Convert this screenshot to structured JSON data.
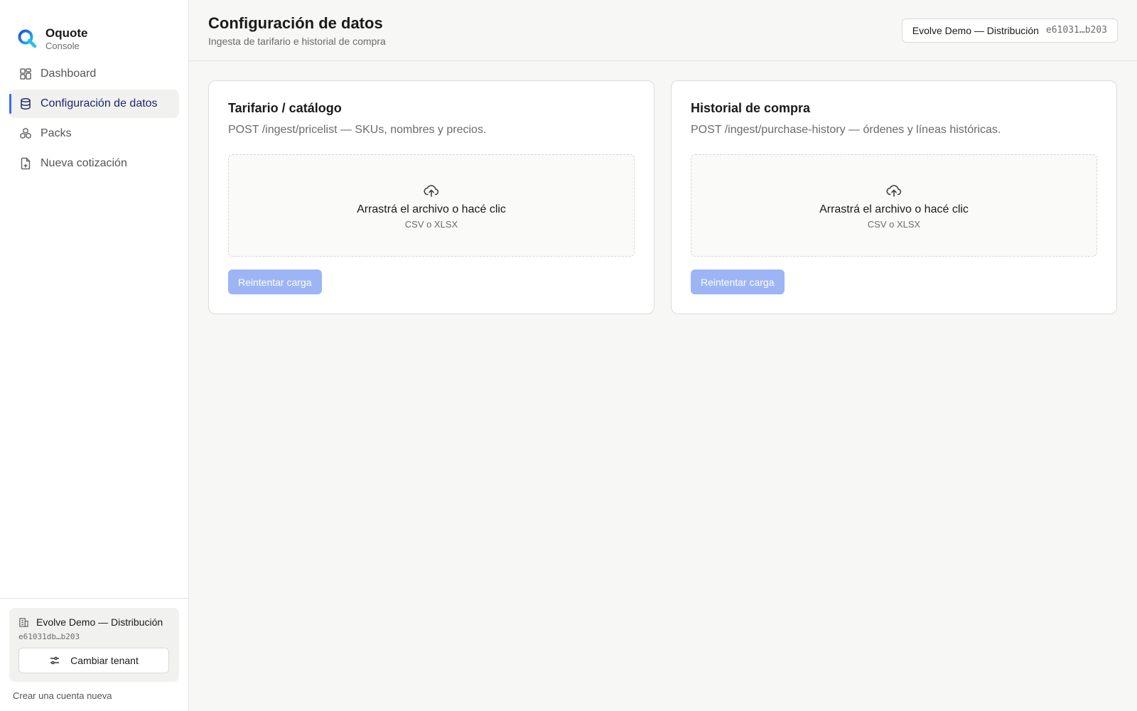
{
  "brand": {
    "name": "Oquote",
    "subtitle": "Console",
    "accent": "#2f6df6"
  },
  "sidebar": {
    "items": [
      {
        "label": "Dashboard",
        "icon": "dashboard-icon",
        "active": false
      },
      {
        "label": "Configuración de datos",
        "icon": "database-icon",
        "active": true
      },
      {
        "label": "Packs",
        "icon": "packs-icon",
        "active": false
      },
      {
        "label": "Nueva cotización",
        "icon": "file-plus-icon",
        "active": false
      }
    ],
    "tenant": {
      "name": "Evolve Demo — Distribución",
      "id": "e61031db…b203",
      "switch_label": "Cambiar tenant"
    },
    "new_account": "Crear una cuenta nueva"
  },
  "header": {
    "title": "Configuración de datos",
    "subtitle": "Ingesta de tarifario e historial de compra",
    "tenant_chip": {
      "name": "Evolve Demo — Distribución",
      "id": "e61031…b203"
    }
  },
  "cards": [
    {
      "title": "Tarifario / catálogo",
      "description": "POST /ingest/pricelist — SKUs, nombres y precios.",
      "dropzone_title": "Arrastrá el archivo o hacé clic",
      "dropzone_sub": "CSV o XLSX",
      "retry_label": "Reintentar carga"
    },
    {
      "title": "Historial de compra",
      "description": "POST /ingest/purchase-history — órdenes y líneas históricas.",
      "dropzone_title": "Arrastrá el archivo o hacé clic",
      "dropzone_sub": "CSV o XLSX",
      "retry_label": "Reintentar carga"
    }
  ],
  "colors": {
    "retry_button": "#9db5f5",
    "active_nav_text": "#1a2a6c"
  }
}
